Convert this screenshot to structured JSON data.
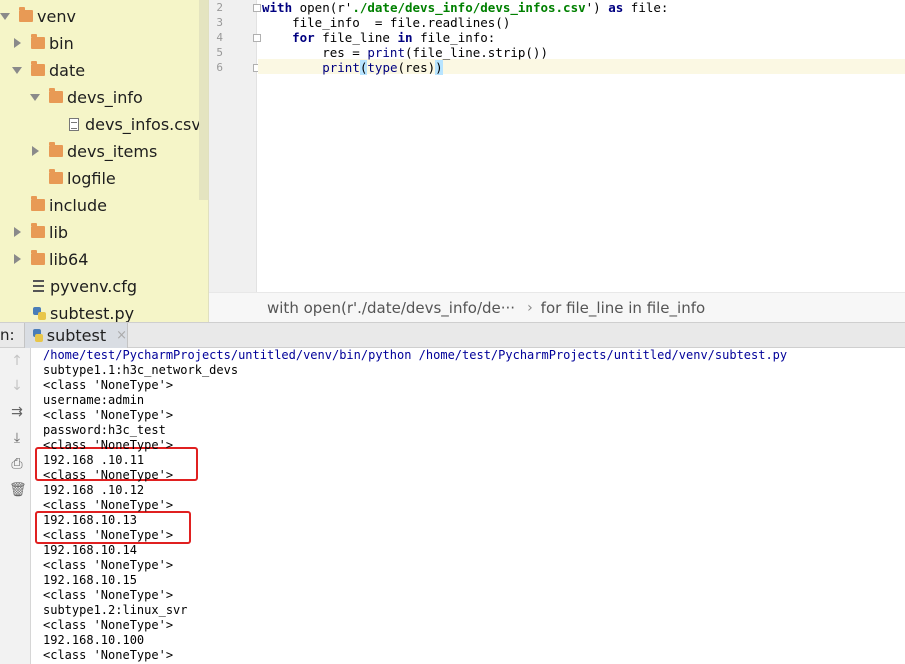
{
  "tree": {
    "items": [
      {
        "label": "venv"
      },
      {
        "label": "bin"
      },
      {
        "label": "date"
      },
      {
        "label": "devs_info"
      },
      {
        "label": "devs_infos.csv"
      },
      {
        "label": "devs_items"
      },
      {
        "label": "logfile"
      },
      {
        "label": "include"
      },
      {
        "label": "lib"
      },
      {
        "label": "lib64"
      },
      {
        "label": "pyvenv.cfg"
      },
      {
        "label": "subtest.py"
      }
    ]
  },
  "editor": {
    "line_numbers": [
      "2",
      "3",
      "4",
      "5",
      "6"
    ],
    "lines": [
      [
        {
          "t": "with",
          "c": "kw"
        },
        {
          "t": " open(r'",
          "c": ""
        },
        {
          "t": "./date/devs_info/devs_infos.csv",
          "c": "str"
        },
        {
          "t": "') ",
          "c": ""
        },
        {
          "t": "as",
          "c": "kw"
        },
        {
          "t": " file:",
          "c": ""
        }
      ],
      [
        {
          "t": "    file_info  = file.readlines()",
          "c": ""
        }
      ],
      [
        {
          "t": "    ",
          "c": ""
        },
        {
          "t": "for",
          "c": "kw"
        },
        {
          "t": " file_line ",
          "c": ""
        },
        {
          "t": "in",
          "c": "kw"
        },
        {
          "t": " file_info:",
          "c": ""
        }
      ],
      [
        {
          "t": "        res = ",
          "c": ""
        },
        {
          "t": "print",
          "c": "bi"
        },
        {
          "t": "(file_line.strip())",
          "c": ""
        }
      ],
      [
        {
          "t": "        ",
          "c": ""
        },
        {
          "t": "print",
          "c": "bi"
        },
        {
          "t": "(",
          "c": "hl"
        },
        {
          "t": "type",
          "c": "bi"
        },
        {
          "t": "(res)",
          "c": ""
        },
        {
          "t": ")",
          "c": "hl"
        }
      ]
    ],
    "breadcrumb": {
      "first": "with open(r'./date/devs_info/de···",
      "separator": "›",
      "second": "for file_line in file_info"
    }
  },
  "run": {
    "label": "n:",
    "tab_label": "subtest",
    "tab_close": "×",
    "console_lines": [
      "/home/test/PycharmProjects/untitled/venv/bin/python /home/test/PycharmProjects/untitled/venv/subtest.py",
      "subtype1.1:h3c_network_devs",
      "<class 'NoneType'>",
      "username:admin",
      "<class 'NoneType'>",
      "password:h3c_test",
      "<class 'NoneType'>",
      "192.168 .10.11",
      "<class 'NoneType'>",
      "192.168 .10.12",
      "<class 'NoneType'>",
      "192.168.10.13",
      "<class 'NoneType'>",
      "192.168.10.14",
      "<class 'NoneType'>",
      "192.168.10.15",
      "<class 'NoneType'>",
      "subtype1.2:linux_svr",
      "<class 'NoneType'>",
      "192.168.10.100",
      "<class 'NoneType'>"
    ]
  },
  "colors": {
    "tree_background": "#f5f5c8",
    "folder": "#e89a55",
    "keyword": "#000080",
    "string": "#008000",
    "highlight_box": "#e02020"
  }
}
